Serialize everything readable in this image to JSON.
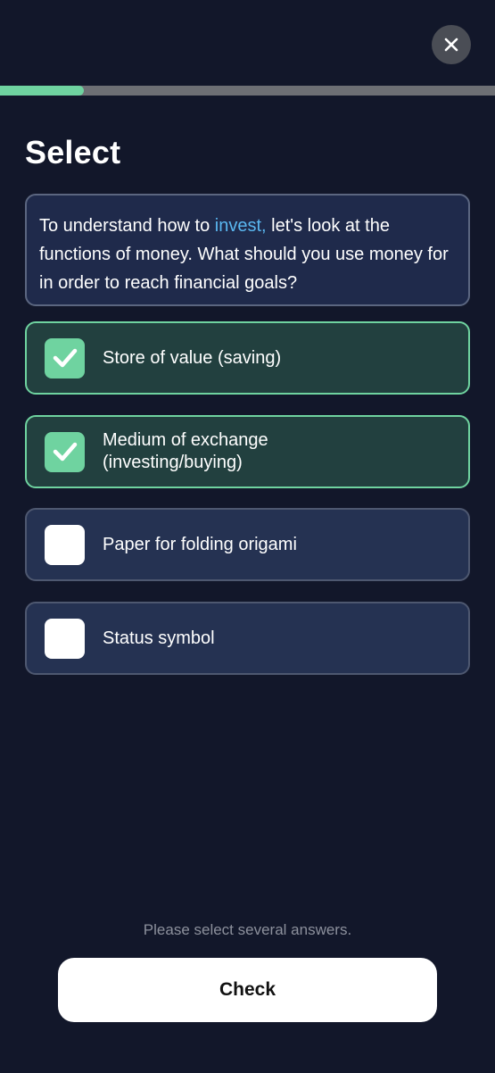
{
  "header": {
    "close_icon": "close-icon",
    "progress_fraction": 0.17
  },
  "page": {
    "title": "Select"
  },
  "question": {
    "text_before": "To understand how to ",
    "highlight": "invest,",
    "text_after": " let's look at the functions of money. What should you use money for in order to reach financial goals?"
  },
  "options": [
    {
      "label": "Store of value (saving)",
      "checked": true
    },
    {
      "label": "Medium of exchange (investing/buying)",
      "checked": true
    },
    {
      "label": "Paper for folding origami",
      "checked": false
    },
    {
      "label": "Status symbol",
      "checked": false
    }
  ],
  "footer": {
    "hint": "Please select several answers.",
    "check_label": "Check"
  },
  "colors": {
    "background": "#12172a",
    "accent_green": "#6fd3a0",
    "highlight_blue": "#5ab7f0",
    "card_blue": "#253252",
    "selected_card": "#22403f"
  }
}
